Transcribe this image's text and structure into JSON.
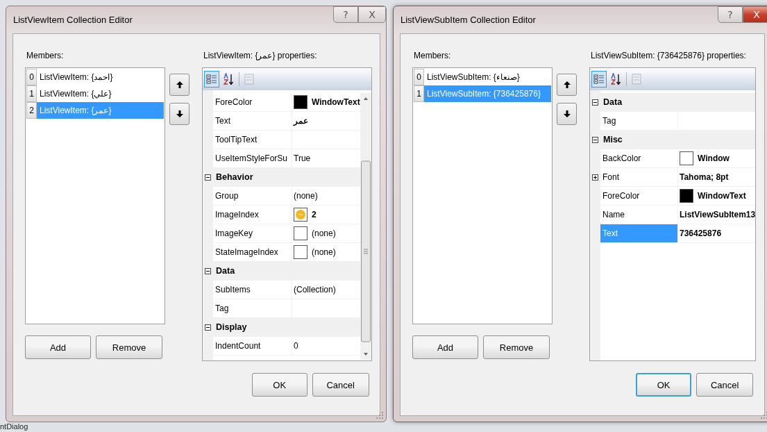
{
  "background": {
    "text": "ntDialog"
  },
  "dialogs": [
    {
      "title": "ListViewItem Collection Editor",
      "active": false,
      "help_button": "?",
      "close_button": "X",
      "members_label": "Members:",
      "members": [
        {
          "index": "0",
          "label": "ListViewItem: {احمد}",
          "selected": false
        },
        {
          "index": "1",
          "label": "ListViewItem: {علي}",
          "selected": false
        },
        {
          "index": "2",
          "label": "ListViewItem: {عمر}",
          "selected": true
        }
      ],
      "properties_label": "ListViewItem: {عمر} properties:",
      "toolbar": [
        {
          "kind": "categorized",
          "selected": true,
          "disabled": false
        },
        {
          "kind": "alphabetical",
          "selected": false,
          "disabled": false
        },
        {
          "kind": "property-pages",
          "selected": false,
          "disabled": true
        }
      ],
      "has_scrollbar": true,
      "grid": [
        {
          "kind": "property",
          "name": "ForeColor",
          "value": "WindowText",
          "modified": true,
          "selected": false,
          "color": "#000000"
        },
        {
          "kind": "property",
          "name": "Text",
          "value": "عمر",
          "modified": true,
          "selected": false
        },
        {
          "kind": "property",
          "name": "ToolTipText",
          "selected": false
        },
        {
          "kind": "property",
          "name": "UseItemStyleForSu",
          "value": "True",
          "modified": false,
          "selected": false
        },
        {
          "kind": "category",
          "label": "Behavior",
          "expanded": true
        },
        {
          "kind": "property",
          "name": "Group",
          "value": "(none)",
          "modified": false,
          "selected": false
        },
        {
          "kind": "property",
          "name": "ImageIndex",
          "value": "2",
          "modified": true,
          "selected": false,
          "image_swatch": true
        },
        {
          "kind": "property",
          "name": "ImageKey",
          "value": "(none)",
          "modified": false,
          "selected": false,
          "color": "#ffffff"
        },
        {
          "kind": "property",
          "name": "StateImageIndex",
          "value": "(none)",
          "modified": false,
          "selected": false,
          "color": "#ffffff"
        },
        {
          "kind": "category",
          "label": "Data",
          "expanded": true
        },
        {
          "kind": "property",
          "name": "SubItems",
          "value": "(Collection)",
          "modified": false,
          "selected": false
        },
        {
          "kind": "property",
          "name": "Tag",
          "selected": false
        },
        {
          "kind": "category",
          "label": "Display",
          "expanded": true
        },
        {
          "kind": "property",
          "name": "IndentCount",
          "value": "0",
          "modified": false,
          "selected": false
        }
      ],
      "add_button": "Add",
      "remove_button": "Remove",
      "ok_button": {
        "label": "OK",
        "focused": false
      },
      "cancel_button": {
        "label": "Cancel",
        "focused": false
      }
    },
    {
      "title": "ListViewSubItem Collection Editor",
      "active": true,
      "help_button": "?",
      "close_button": "X",
      "members_label": "Members:",
      "members": [
        {
          "index": "0",
          "label": "ListViewSubItem: {صنعاء}",
          "selected": false
        },
        {
          "index": "1",
          "label": "ListViewSubItem: {736425876}",
          "selected": true
        }
      ],
      "properties_label": "ListViewSubItem: {736425876} properties:",
      "toolbar": [
        {
          "kind": "categorized",
          "selected": true,
          "disabled": false
        },
        {
          "kind": "alphabetical",
          "selected": false,
          "disabled": false
        },
        {
          "kind": "property-pages",
          "selected": false,
          "disabled": true
        }
      ],
      "has_scrollbar": false,
      "grid": [
        {
          "kind": "category",
          "label": "Data",
          "expanded": true
        },
        {
          "kind": "property",
          "name": "Tag",
          "selected": false
        },
        {
          "kind": "category",
          "label": "Misc",
          "expanded": true
        },
        {
          "kind": "property",
          "name": "BackColor",
          "value": "Window",
          "modified": true,
          "selected": false,
          "color": "#ffffff"
        },
        {
          "kind": "property",
          "name": "Font",
          "value": "Tahoma; 8pt",
          "modified": true,
          "selected": false,
          "expanded": false
        },
        {
          "kind": "property",
          "name": "ForeColor",
          "value": "WindowText",
          "modified": true,
          "selected": false,
          "color": "#000000"
        },
        {
          "kind": "property",
          "name": "Name",
          "value": "ListViewSubItem13",
          "modified": true,
          "selected": false
        },
        {
          "kind": "property",
          "name": "Text",
          "value": "736425876",
          "modified": true,
          "selected": true
        }
      ],
      "add_button": "Add",
      "remove_button": "Remove",
      "ok_button": {
        "label": "OK",
        "focused": true
      },
      "cancel_button": {
        "label": "Cancel",
        "focused": false
      }
    }
  ]
}
